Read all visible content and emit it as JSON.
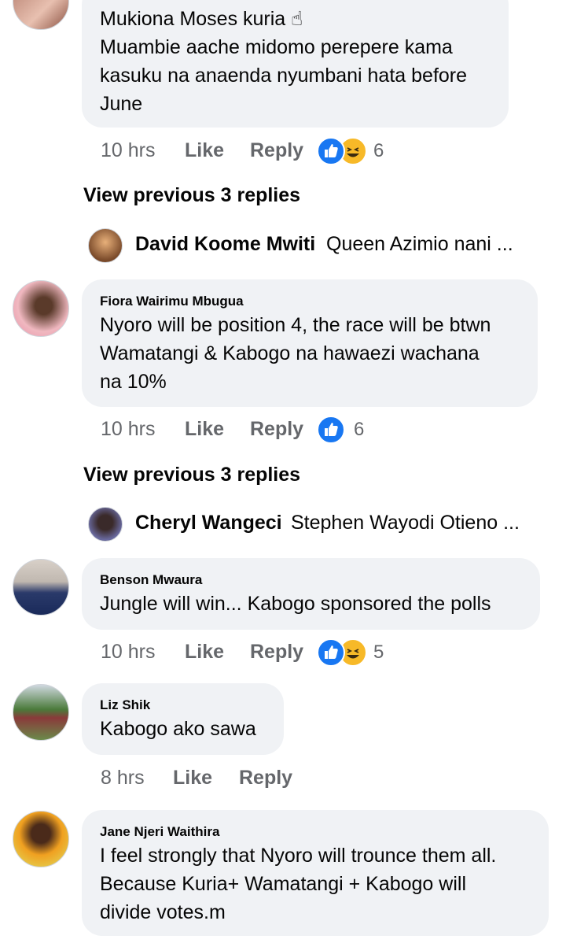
{
  "comments": [
    {
      "text": "Mukiona Moses kuria ☝\nMuambie aache midomo perepere kama\nkasuku na anaenda nyumbani hata before\nJune",
      "time": "10 hrs",
      "like": "Like",
      "reply": "Reply",
      "reaction_count": "6",
      "reactions": [
        "like-icon",
        "haha-icon"
      ]
    },
    {
      "author": "Fiora Wairimu Mbugua",
      "text": "Nyoro will be position 4, the race will be btwn\nWamatangi & Kabogo  na hawaezi wachana\nna 10%",
      "time": "10 hrs",
      "like": "Like",
      "reply": "Reply",
      "reaction_count": "6",
      "reactions": [
        "like-icon"
      ]
    },
    {
      "author": "Benson Mwaura",
      "text": "Jungle will win... Kabogo sponsored the polls",
      "time": "10 hrs",
      "like": "Like",
      "reply": "Reply",
      "reaction_count": "5",
      "reactions": [
        "like-icon",
        "haha-icon"
      ]
    },
    {
      "author": "Liz Shik",
      "text": "Kabogo ako sawa",
      "time": "8 hrs",
      "like": "Like",
      "reply": "Reply"
    },
    {
      "author": "Jane Njeri Waithira",
      "text": "I feel strongly that Nyoro will trounce them all.\nBecause Kuria+ Wamatangi + Kabogo will\ndivide votes.m"
    }
  ],
  "threads": [
    {
      "view_previous": "View previous 3 replies",
      "reply_author": "David Koome Mwiti",
      "reply_preview": "Queen Azimio nani ..."
    },
    {
      "view_previous": "View previous 3 replies",
      "reply_author": "Cheryl Wangeci",
      "reply_preview": "Stephen Wayodi Otieno ..."
    }
  ],
  "colors": {
    "bubble": "#f0f2f5",
    "meta": "#65676b",
    "like_blue": "#1877f2",
    "haha_yellow": "#f7b928"
  }
}
